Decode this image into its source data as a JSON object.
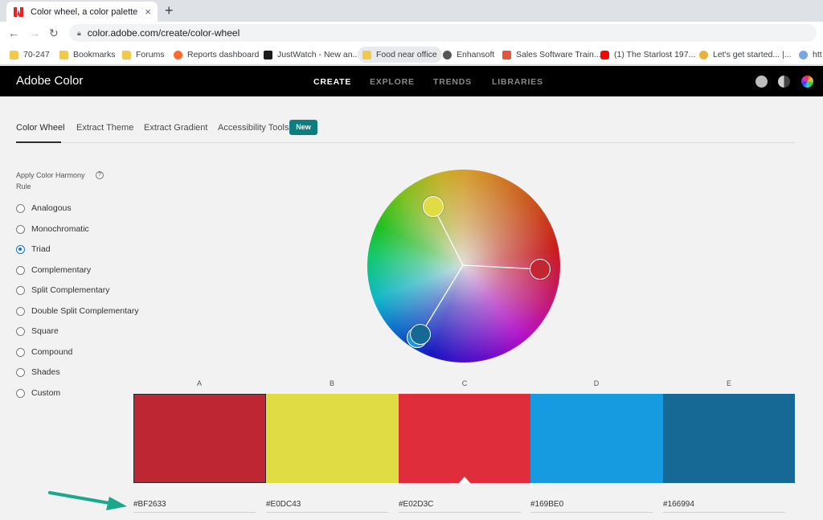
{
  "browser": {
    "tab_title": "Color wheel, a color palette gene",
    "tab_close": "×",
    "new_tab": "+",
    "url": "color.adobe.com/create/color-wheel",
    "bookmarks": [
      "70-247",
      "Bookmarks",
      "Forums",
      "Reports dashboard",
      "JustWatch - New an...",
      "Food near office",
      "Enhansoft",
      "Sales Software Train...",
      "(1) The Starlost 197...",
      "Let's get started... |...",
      "htt"
    ]
  },
  "header": {
    "brand": "Adobe Color",
    "nav": [
      "CREATE",
      "EXPLORE",
      "TRENDS",
      "LIBRARIES"
    ]
  },
  "subtabs": {
    "items": [
      "Color Wheel",
      "Extract Theme",
      "Extract Gradient",
      "Accessibility Tools"
    ],
    "badge": "New"
  },
  "harmony": {
    "title": "Apply Color Harmony Rule",
    "help": "?",
    "rules": [
      "Analogous",
      "Monochromatic",
      "Triad",
      "Complementary",
      "Split Complementary",
      "Double Split Complementary",
      "Square",
      "Compound",
      "Shades",
      "Custom"
    ],
    "selected": "Triad"
  },
  "swatches": {
    "labels": [
      "A",
      "B",
      "C",
      "D",
      "E"
    ],
    "hex": [
      "#BF2633",
      "#E0DC43",
      "#E02D3C",
      "#169BE0",
      "#166994"
    ],
    "colors": [
      "#bf2633",
      "#e0dc43",
      "#e02d3c",
      "#169be0",
      "#166994"
    ],
    "selected": "C"
  },
  "colors": {
    "accent": "#1473e6",
    "badge": "#0d7d7d",
    "arrow": "#1aa88a"
  }
}
